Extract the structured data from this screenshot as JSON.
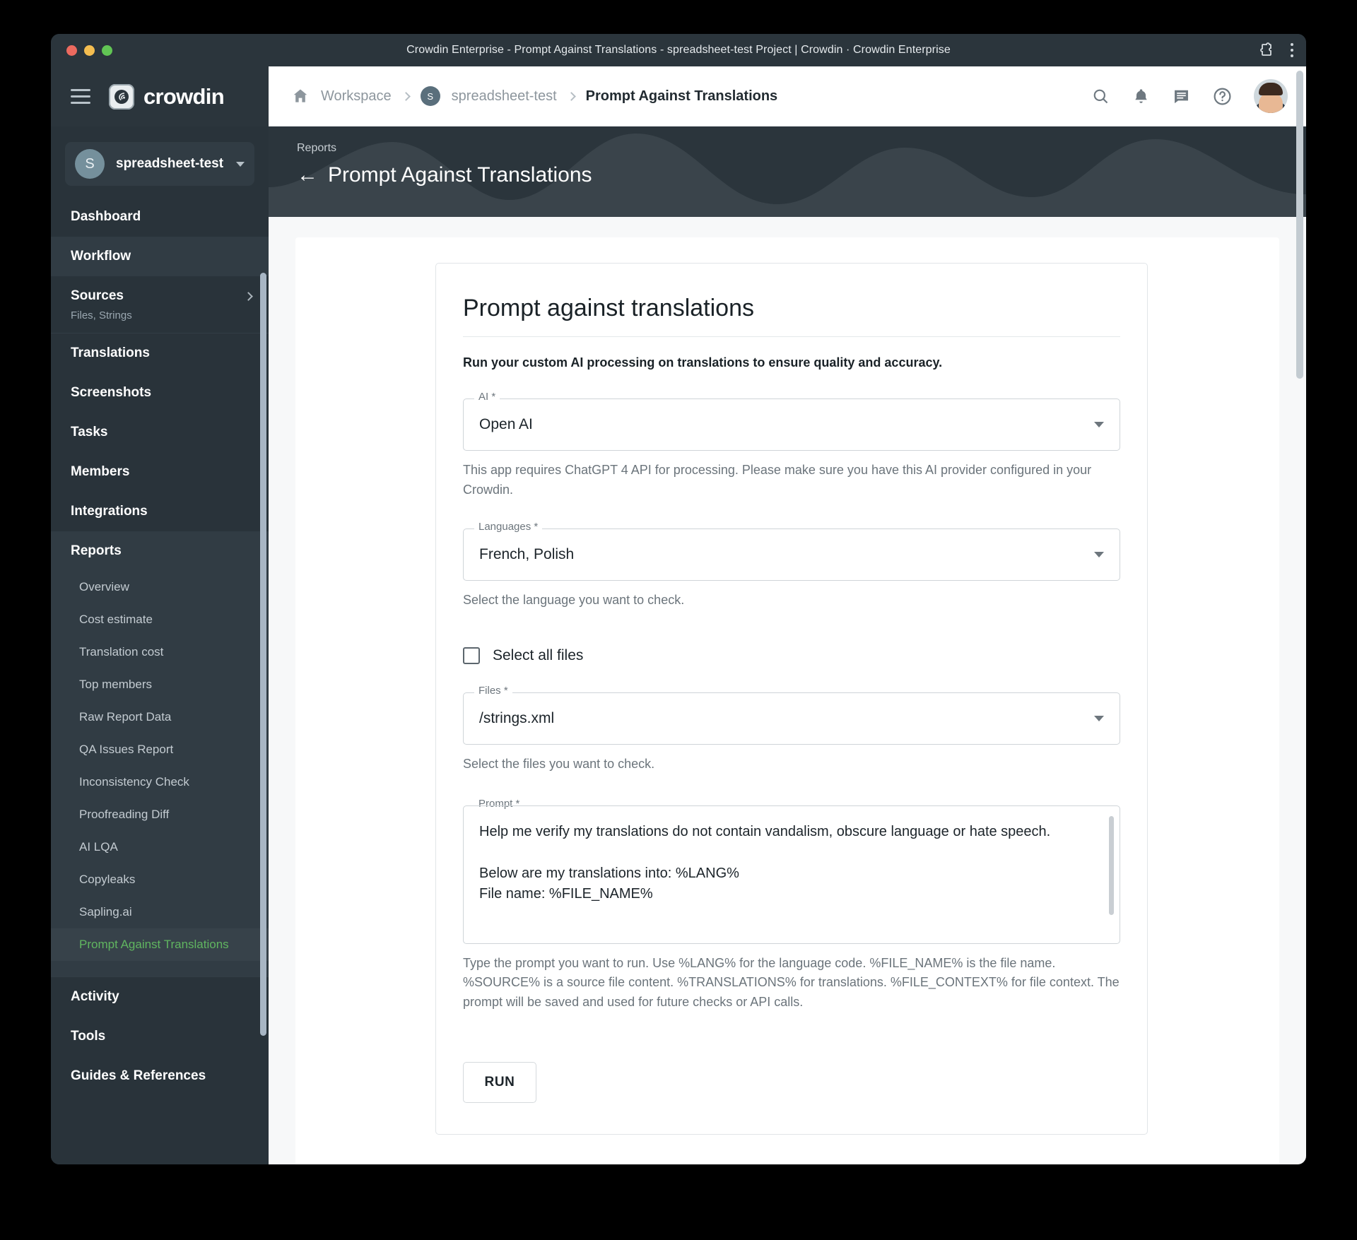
{
  "window": {
    "title": "Crowdin Enterprise - Prompt Against Translations - spreadsheet-test Project | Crowdin · Crowdin Enterprise"
  },
  "sidebar": {
    "brand": "crowdin",
    "project": {
      "initial": "S",
      "name": "spreadsheet-test"
    },
    "items": [
      {
        "label": "Dashboard",
        "sub": ""
      },
      {
        "label": "Workflow",
        "sub": ""
      },
      {
        "label": "Sources",
        "sub": "Files, Strings"
      },
      {
        "label": "Translations",
        "sub": ""
      },
      {
        "label": "Screenshots",
        "sub": ""
      },
      {
        "label": "Tasks",
        "sub": ""
      },
      {
        "label": "Members",
        "sub": ""
      },
      {
        "label": "Integrations",
        "sub": ""
      },
      {
        "label": "Reports",
        "sub": ""
      },
      {
        "label": "Activity",
        "sub": ""
      },
      {
        "label": "Tools",
        "sub": ""
      },
      {
        "label": "Guides & References",
        "sub": ""
      }
    ],
    "reports_children": [
      "Overview",
      "Cost estimate",
      "Translation cost",
      "Top members",
      "Raw Report Data",
      "QA Issues Report",
      "Inconsistency Check",
      "Proofreading Diff",
      "AI LQA",
      "Copyleaks",
      "Sapling.ai",
      "Prompt Against Translations"
    ],
    "active_child": "Prompt Against Translations",
    "active_color": "#60b560"
  },
  "topbar": {
    "breadcrumb": [
      "Workspace",
      "spreadsheet-test",
      "Prompt Against Translations"
    ],
    "project_badge": "S",
    "icons": [
      "search-icon",
      "bell-icon",
      "chat-icon",
      "help-icon",
      "avatar"
    ]
  },
  "hero": {
    "kicker": "Reports",
    "back": "←",
    "title": "Prompt Against Translations"
  },
  "form": {
    "title": "Prompt against translations",
    "subtitle": "Run your custom AI processing on translations to ensure quality and accuracy.",
    "ai": {
      "legend": "AI *",
      "value": "Open AI",
      "help": "This app requires ChatGPT 4 API for processing. Please make sure you have this AI provider configured in your Crowdin."
    },
    "languages": {
      "legend": "Languages *",
      "value": "French, Polish",
      "help": "Select the language you want to check."
    },
    "select_all_files": {
      "label": "Select all files",
      "checked": false
    },
    "files": {
      "legend": "Files *",
      "value": "/strings.xml",
      "help": "Select the files you want to check."
    },
    "prompt": {
      "legend": "Prompt *",
      "value": "Help me verify my translations do not contain vandalism, obscure language or hate speech.\n\nBelow are my translations into: %LANG%\nFile name: %FILE_NAME%",
      "help": "Type the prompt you want to run. Use %LANG% for the language code. %FILE_NAME% is the file name. %SOURCE% is a source file content. %TRANSLATIONS% for translations. %FILE_CONTEXT% for file context. The prompt will be saved and used for future checks or API calls."
    },
    "run_label": "RUN"
  }
}
